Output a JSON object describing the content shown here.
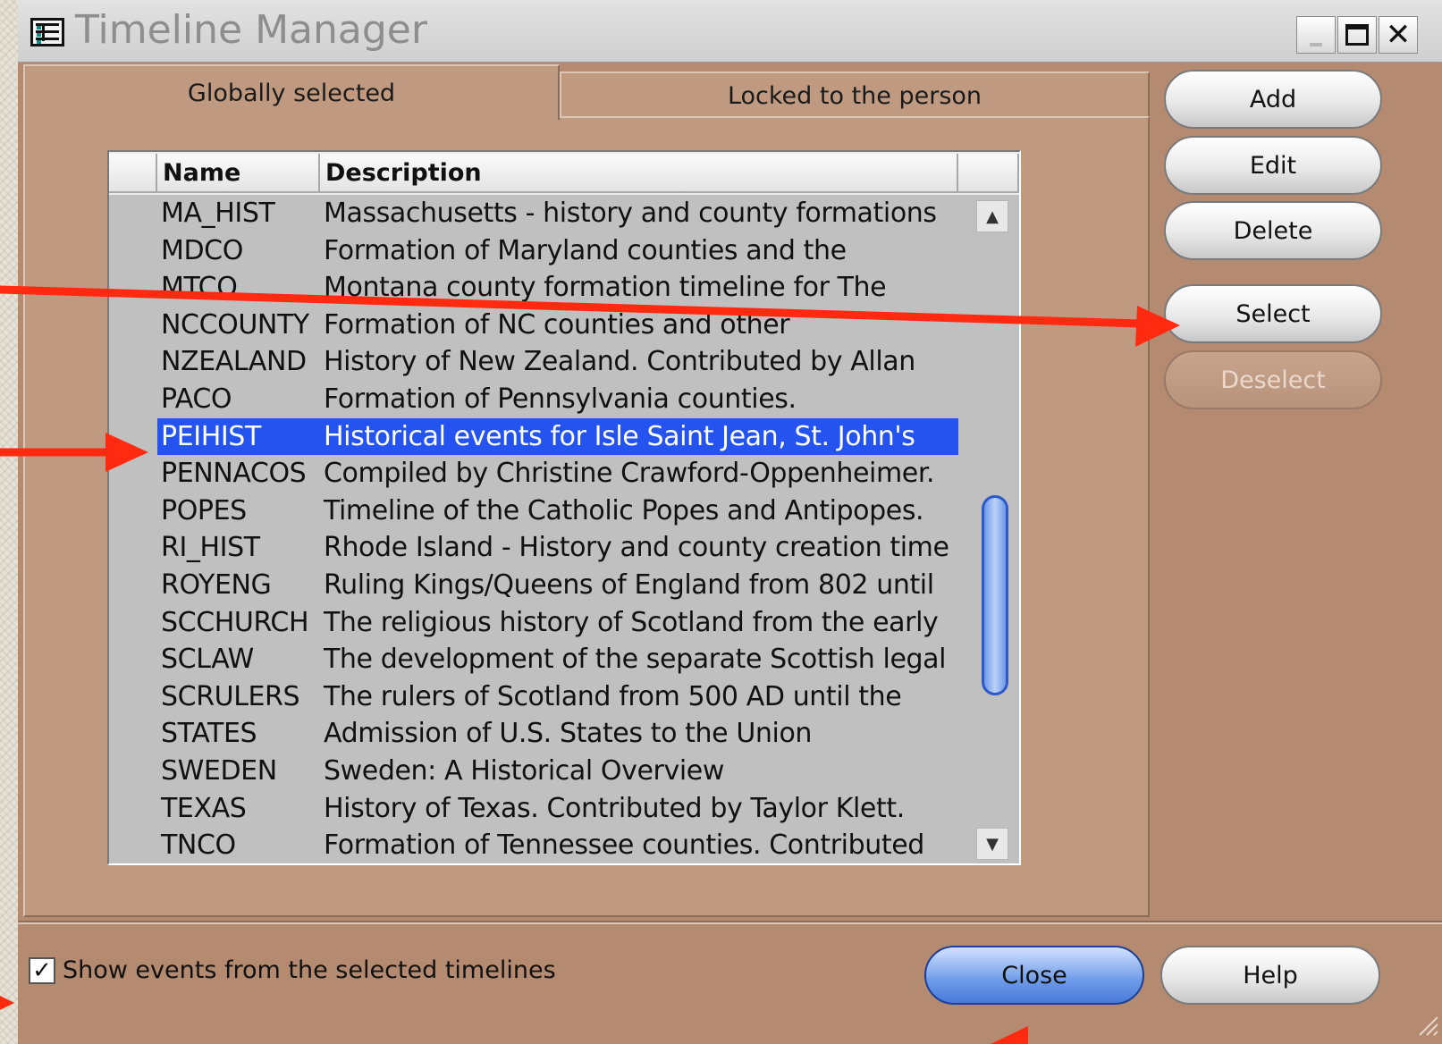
{
  "window": {
    "title": "Timeline Manager",
    "icon": "timeline-table-icon"
  },
  "tabs": [
    {
      "label": "Globally selected",
      "active": true
    },
    {
      "label": "Locked to the person",
      "active": false
    }
  ],
  "table": {
    "columns": [
      "Name",
      "Description"
    ],
    "rows": [
      {
        "name": "MA_HIST",
        "description": "Massachusetts - history and county formations"
      },
      {
        "name": "MDCO",
        "description": "Formation of Maryland counties and the"
      },
      {
        "name": "MTCO",
        "description": "Montana county formation timeline for The"
      },
      {
        "name": "NCCOUNTY",
        "description": "Formation of NC counties and other"
      },
      {
        "name": "NZEALAND",
        "description": "History of New Zealand. Contributed by Allan"
      },
      {
        "name": "PACO",
        "description": "Formation of Pennsylvania counties."
      },
      {
        "name": "PEIHIST",
        "description": "Historical events for Isle Saint Jean, St. John's"
      },
      {
        "name": "PENNACOS",
        "description": "Compiled by Christine Crawford-Oppenheimer."
      },
      {
        "name": "POPES",
        "description": "Timeline of the Catholic Popes and Antipopes."
      },
      {
        "name": "RI_HIST",
        "description": "Rhode Island - History and county creation time"
      },
      {
        "name": "ROYENG",
        "description": "Ruling Kings/Queens of England from 802 until"
      },
      {
        "name": "SCCHURCH",
        "description": "The religious history of Scotland from the early"
      },
      {
        "name": "SCLAW",
        "description": "The development of the separate Scottish legal"
      },
      {
        "name": "SCRULERS",
        "description": "The rulers of Scotland from 500 AD until the"
      },
      {
        "name": "STATES",
        "description": "Admission of U.S. States to the Union"
      },
      {
        "name": "SWEDEN",
        "description": "Sweden: A Historical Overview"
      },
      {
        "name": "TEXAS",
        "description": "History of Texas.  Contributed by Taylor Klett."
      },
      {
        "name": "TNCO",
        "description": "Formation of Tennessee counties. Contributed"
      }
    ],
    "selected_index": 6
  },
  "buttons": {
    "add": "Add",
    "edit": "Edit",
    "delete": "Delete",
    "select": "Select",
    "deselect": "Deselect",
    "close": "Close",
    "help": "Help"
  },
  "footer": {
    "checkbox_label": "Show events from the selected timelines",
    "checkbox_checked": true
  },
  "colors": {
    "window_bg": "#b48a70",
    "panel_bg": "#c09a80",
    "selection": "#2453f0",
    "annotation_arrow": "#ff2a10"
  }
}
